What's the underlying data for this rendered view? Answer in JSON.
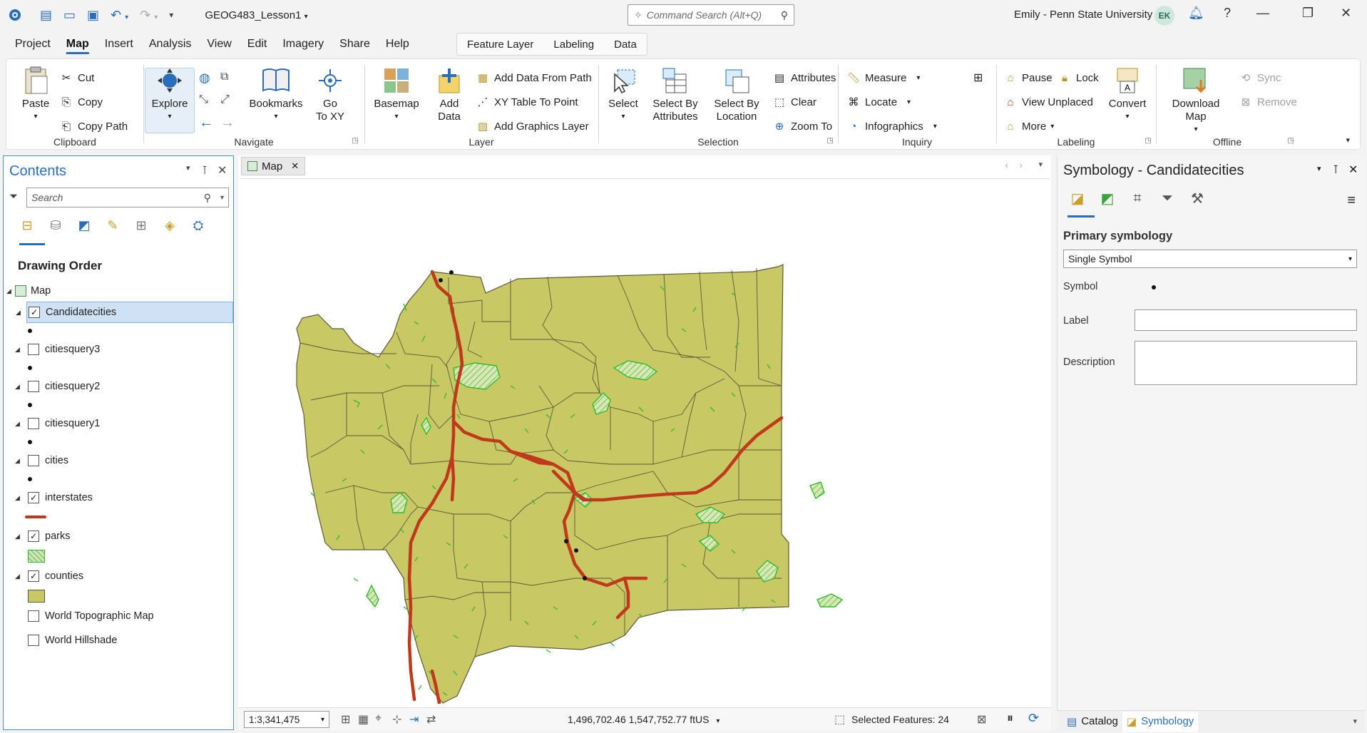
{
  "titlebar": {
    "project_title": "GEOG483_Lesson1",
    "search_placeholder": "Command Search (Alt+Q)",
    "user": "Emily - Penn State University",
    "avatar_initials": "EK"
  },
  "menu": {
    "items": [
      "Project",
      "Map",
      "Insert",
      "Analysis",
      "View",
      "Edit",
      "Imagery",
      "Share",
      "Help"
    ],
    "active": "Map",
    "context_tabs": [
      "Feature Layer",
      "Labeling",
      "Data"
    ]
  },
  "ribbon": {
    "clipboard": {
      "label": "Clipboard",
      "paste": "Paste",
      "cut": "Cut",
      "copy": "Copy",
      "copy_path": "Copy Path"
    },
    "navigate": {
      "label": "Navigate",
      "explore": "Explore",
      "bookmarks": "Bookmarks",
      "goto_xy": "Go\nTo XY"
    },
    "layer": {
      "label": "Layer",
      "basemap": "Basemap",
      "add_data": "Add\nData",
      "add_data_from_path": "Add Data From Path",
      "xy_table": "XY Table To Point",
      "add_graphics": "Add Graphics Layer"
    },
    "selection": {
      "label": "Selection",
      "select": "Select",
      "select_by_attributes": "Select By\nAttributes",
      "select_by_location": "Select By\nLocation",
      "attributes": "Attributes",
      "clear": "Clear",
      "zoom_to": "Zoom To"
    },
    "inquiry": {
      "label": "Inquiry",
      "measure": "Measure",
      "locate": "Locate",
      "infographics": "Infographics"
    },
    "labeling": {
      "label": "Labeling",
      "pause": "Pause",
      "lock": "Lock",
      "view_unplaced": "View Unplaced",
      "more": "More",
      "convert": "Convert"
    },
    "offline": {
      "label": "Offline",
      "download_map": "Download\nMap",
      "sync": "Sync",
      "remove": "Remove"
    }
  },
  "contents": {
    "title": "Contents",
    "search_placeholder": "Search",
    "drawing_order": "Drawing Order",
    "map_label": "Map",
    "layers": [
      {
        "name": "Candidatecities",
        "checked": true,
        "symbol": "dot"
      },
      {
        "name": "citiesquery3",
        "checked": false,
        "symbol": "dot"
      },
      {
        "name": "citiesquery2",
        "checked": false,
        "symbol": "dot"
      },
      {
        "name": "citiesquery1",
        "checked": false,
        "symbol": "dot"
      },
      {
        "name": "cities",
        "checked": false,
        "symbol": "dot"
      },
      {
        "name": "interstates",
        "checked": true,
        "symbol": "line"
      },
      {
        "name": "parks",
        "checked": true,
        "symbol": "hatch"
      },
      {
        "name": "counties",
        "checked": true,
        "symbol": "fill"
      },
      {
        "name": "World Topographic Map",
        "checked": false,
        "symbol": "none"
      },
      {
        "name": "World Hillshade",
        "checked": false,
        "symbol": "none"
      }
    ]
  },
  "map": {
    "tab_label": "Map",
    "scale": "1:3,341,475",
    "coordinates": "1,496,702.46 1,547,752.77 ftUS",
    "selected_features": "Selected Features: 24",
    "colors": {
      "county_fill": "#c8c864",
      "county_stroke": "#5a5a3a",
      "interstate": "#c0391b",
      "park": "#2dbb2d"
    }
  },
  "symbology": {
    "title": "Symbology - Candidatecities",
    "primary_label": "Primary symbology",
    "primary_value": "Single Symbol",
    "symbol_label": "Symbol",
    "label_label": "Label",
    "description_label": "Description"
  },
  "bottom_tabs": {
    "catalog": "Catalog",
    "symbology": "Symbology"
  }
}
